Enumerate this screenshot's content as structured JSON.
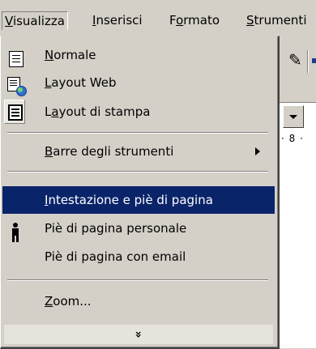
{
  "menubar": {
    "items": [
      {
        "label": "Visualizza",
        "accel": "V",
        "rest": "isualizza"
      },
      {
        "label": "Inserisci",
        "accel": "I",
        "rest": "nserisci"
      },
      {
        "label": "Formato",
        "pre": "F",
        "accel": "o",
        "rest": "rmato"
      },
      {
        "label": "Strumenti",
        "accel": "S",
        "rest": "trumenti"
      }
    ]
  },
  "menu": {
    "items": [
      {
        "label": "Normale",
        "accel": "N",
        "rest": "ormale",
        "icon": "normal-view-icon"
      },
      {
        "label": "Layout Web",
        "accel": "L",
        "rest": "ayout Web",
        "icon": "web-layout-icon"
      },
      {
        "label": "Layout di stampa",
        "pre": "L",
        "accel": "a",
        "rest": "yout di stampa",
        "icon": "print-layout-icon"
      },
      {
        "label": "Barre degli strumenti",
        "accel": "B",
        "rest": "arre degli strumenti",
        "submenu": true
      },
      {
        "label": "Intestazione e piè di pagina",
        "accel": "I",
        "rest": "ntestazione e piè di pagina",
        "highlighted": true
      },
      {
        "label": "Piè di pagina personale",
        "icon": "person-icon"
      },
      {
        "label": "Piè di pagina con email"
      },
      {
        "label": "Zoom...",
        "accel": "Z",
        "rest": "oom..."
      }
    ],
    "expand_glyph": "»"
  },
  "background": {
    "ruler_text": "· 8 ·"
  },
  "colors": {
    "face": "#d4d0c8",
    "highlight": "#0a246a",
    "highlight_text": "#ffffff"
  }
}
